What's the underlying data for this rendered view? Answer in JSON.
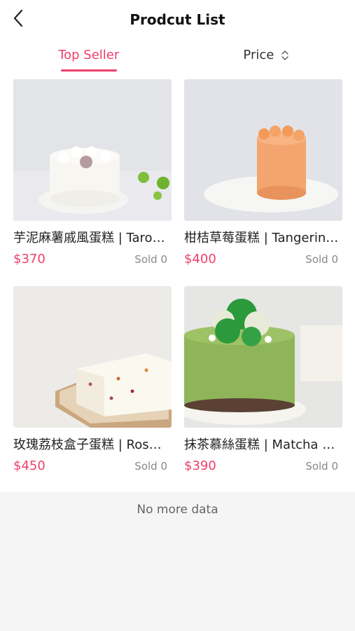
{
  "header": {
    "title": "Prodcut List",
    "back_icon": "chevron-left-icon"
  },
  "tabs": [
    {
      "label": "Top Seller",
      "active": true
    },
    {
      "label": "Price",
      "active": false,
      "icon": "sort-updown-icon"
    }
  ],
  "products": [
    {
      "name": "芋泥麻薯戚風蛋糕 | Taro Mochi Chiffon Cake",
      "price": "$370",
      "sold": "Sold 0"
    },
    {
      "name": "柑桔草莓蛋糕 | Tangerine Strawberry Cake",
      "price": "$400",
      "sold": "Sold 0"
    },
    {
      "name": "玫瑰荔枝盒子蛋糕 | Rose Lychee Box Cake",
      "price": "$450",
      "sold": "Sold 0"
    },
    {
      "name": "抹茶慕絲蛋糕 | Matcha Mousse Cake",
      "price": "$390",
      "sold": "Sold 0"
    }
  ],
  "footer": {
    "text": "No more data"
  },
  "colors": {
    "accent": "#ef3f6b"
  }
}
